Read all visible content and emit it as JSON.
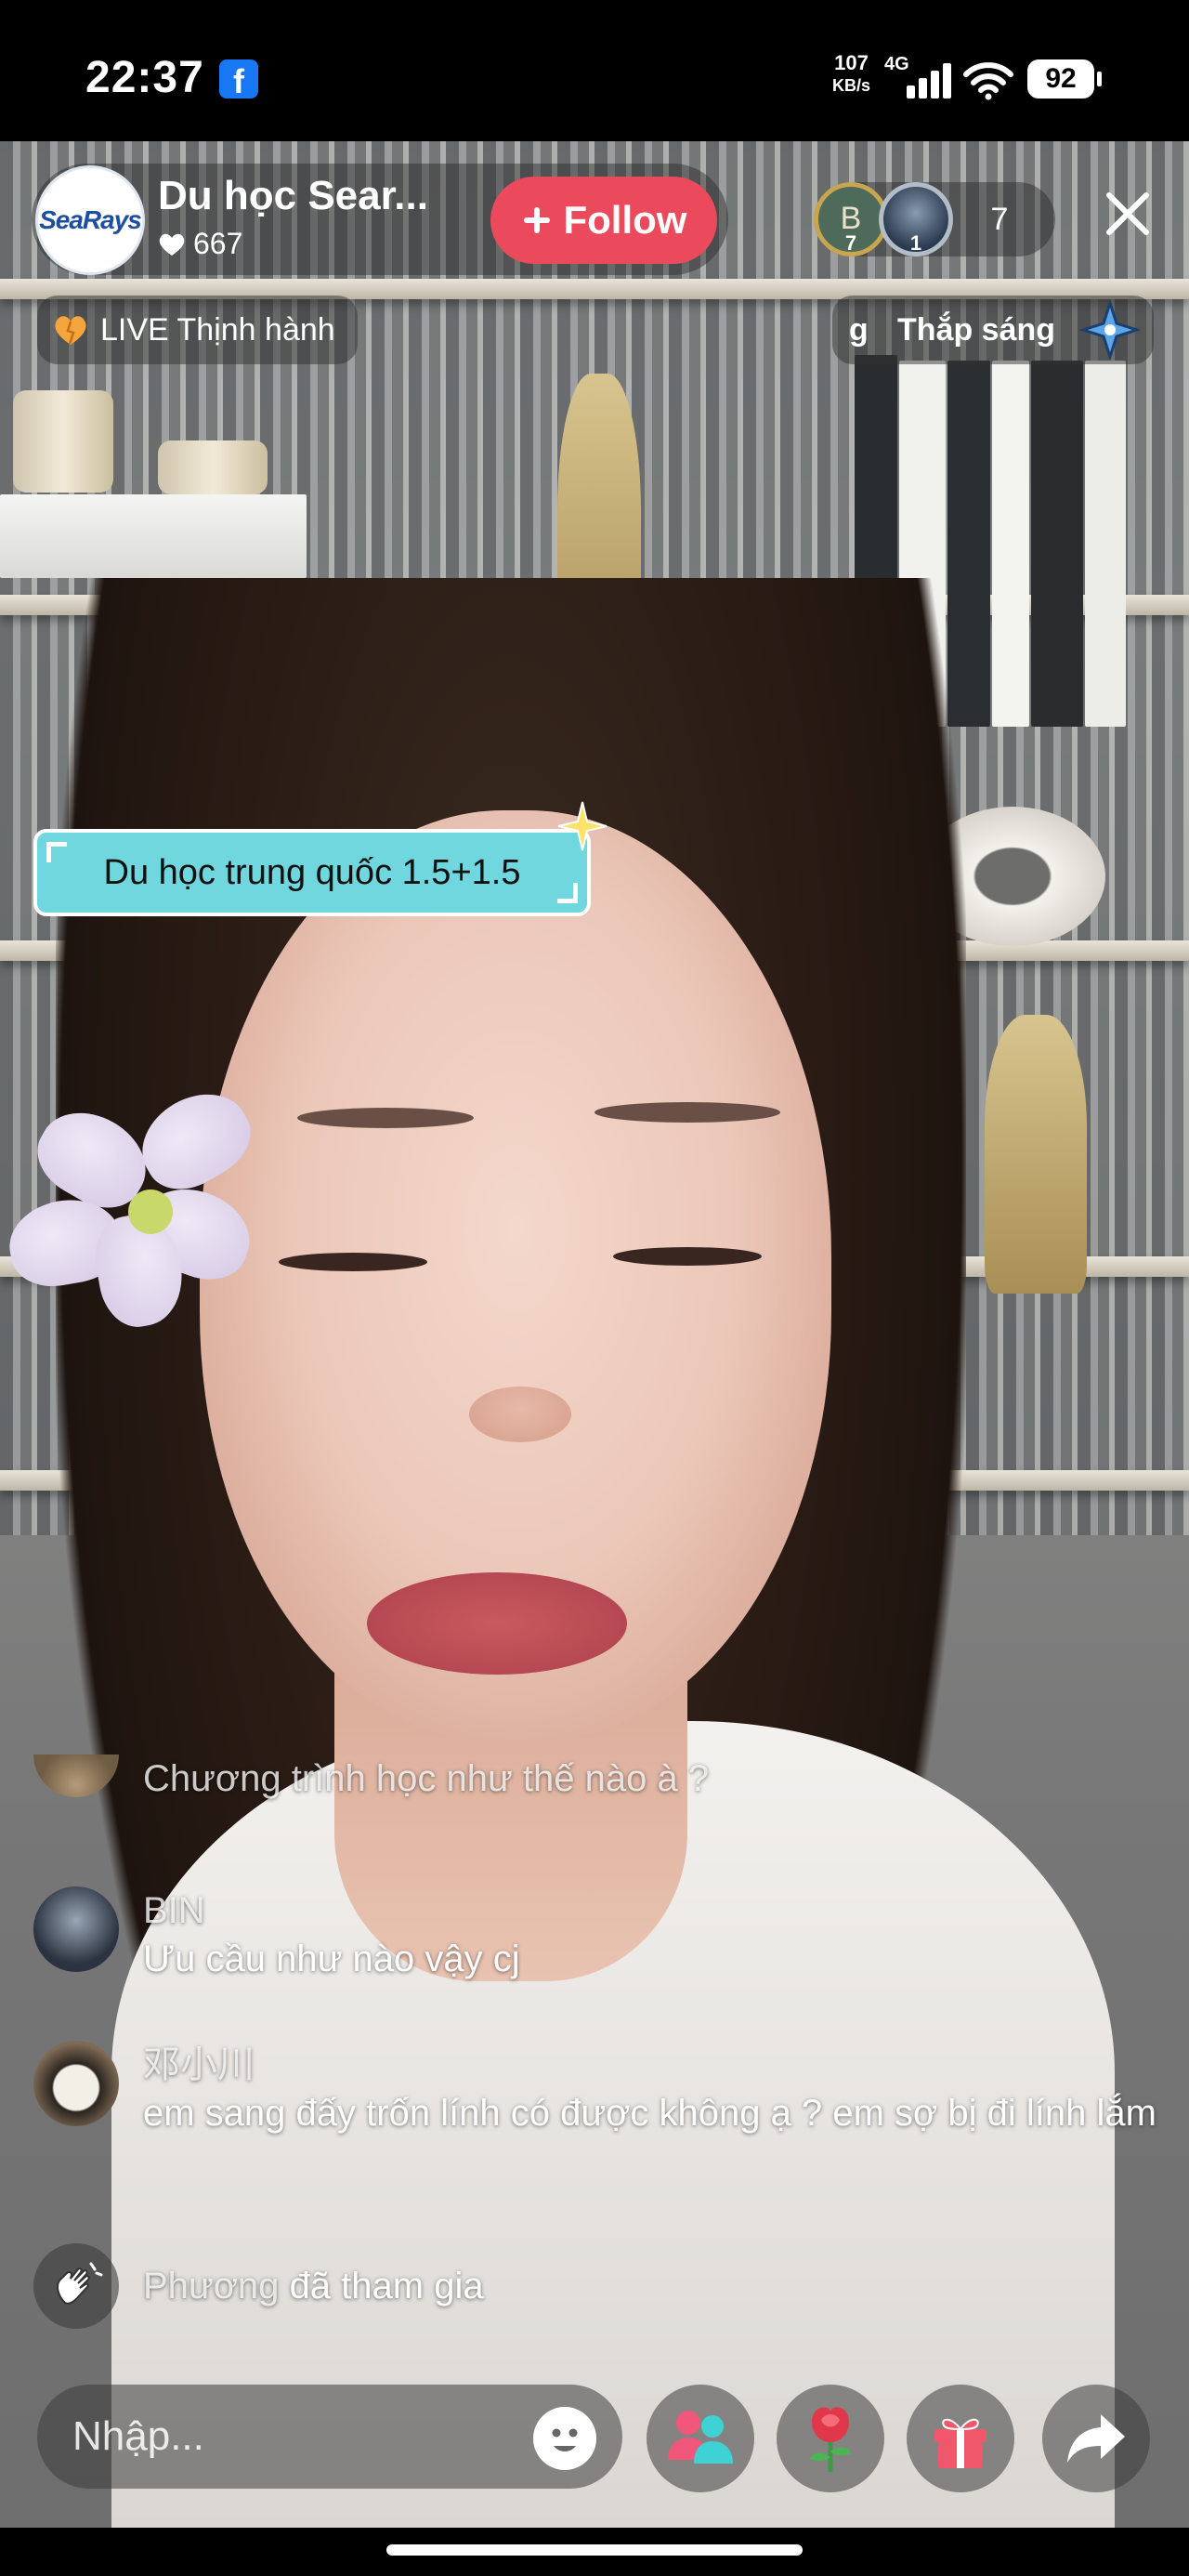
{
  "status_bar": {
    "time": "22:37",
    "notification_app": "f",
    "net_speed_value": "107",
    "net_speed_unit": "KB/s",
    "network": "4G",
    "battery": "92"
  },
  "host": {
    "avatar_logo_text": "SeaRays",
    "name": "Du học Sear...",
    "likes": "667",
    "follow_label": "Follow"
  },
  "viewers": {
    "top": [
      {
        "initial": "B",
        "rank": "7"
      },
      {
        "initial": "",
        "rank": "1"
      }
    ],
    "count": "7"
  },
  "badges": {
    "trending_label": "LIVE Thịnh hành",
    "bright_prefix": "g",
    "bright_label": "Thắp sáng"
  },
  "sticker": {
    "text": "Du học trung quốc 1.5+1.5"
  },
  "comments": [
    {
      "user": "",
      "text": "Chương trình học như thế nào à ?"
    },
    {
      "user": "BIN",
      "text": "Ưu cầu như nào vậy cj"
    },
    {
      "user": "邓小川",
      "text": "em sang đấy trốn lính có được không ạ ? em sợ bị đi lính lắm"
    }
  ],
  "join_event": {
    "user": "Phương",
    "text": "đã tham gia"
  },
  "bottom_bar": {
    "input_placeholder": "Nhập..."
  },
  "colors": {
    "follow": "#ea4a5b",
    "sticker": "#6fd7dd",
    "gift": "#f0576b",
    "rose": "#e0374a"
  }
}
